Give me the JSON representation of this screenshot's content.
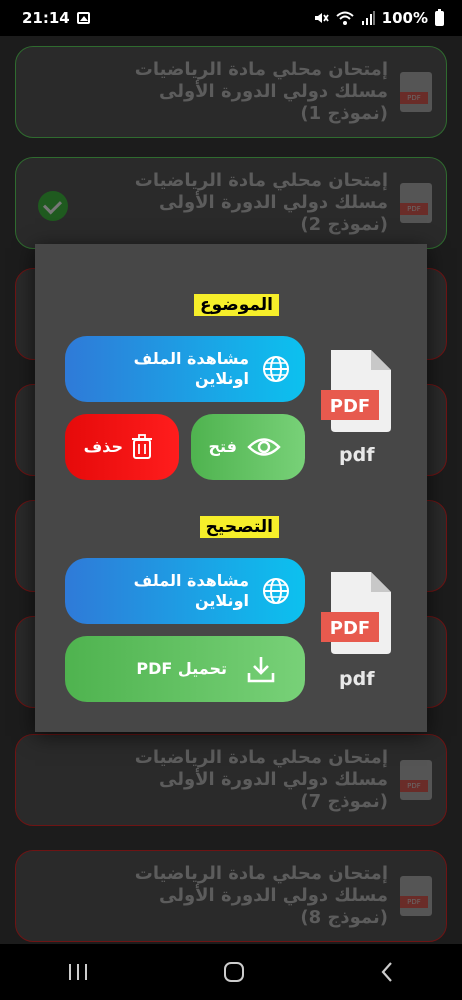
{
  "status": {
    "time": "21:14",
    "battery": "100%"
  },
  "cards": [
    {
      "title": "إمتحان محلي مادة الرياضيات مسلك دولي الدورة الأولى (نموذج 1)",
      "pdf": "PDF"
    },
    {
      "title": "إمتحان محلي مادة الرياضيات مسلك دولي الدورة الأولى (نموذج 2)",
      "pdf": "PDF"
    },
    {
      "title": "إمتحان محلي مادة الرياضيات مسلك دولي الدورة الأولى (نموذج 7)",
      "pdf": "PDF"
    },
    {
      "title": "إمتحان محلي مادة الرياضيات مسلك دولي الدورة الأولى (نموذج 8)",
      "pdf": "PDF"
    }
  ],
  "dialog": {
    "subject": {
      "label": "الموضوع",
      "view_online": "مشاهدة الملف اونلاين",
      "open": "فتح",
      "delete": "حذف",
      "pdf_tag": "PDF",
      "pdf_caption": "pdf"
    },
    "correction": {
      "label": "التصحيح",
      "view_online": "مشاهدة الملف اونلاين",
      "download": "تحميل PDF",
      "pdf_tag": "PDF",
      "pdf_caption": "pdf"
    }
  },
  "colors": {
    "accent_blue": "#0cc1ef",
    "accent_green": "#4fb34f",
    "accent_red": "#e60a0a",
    "label_yellow": "#f6ef2a"
  }
}
